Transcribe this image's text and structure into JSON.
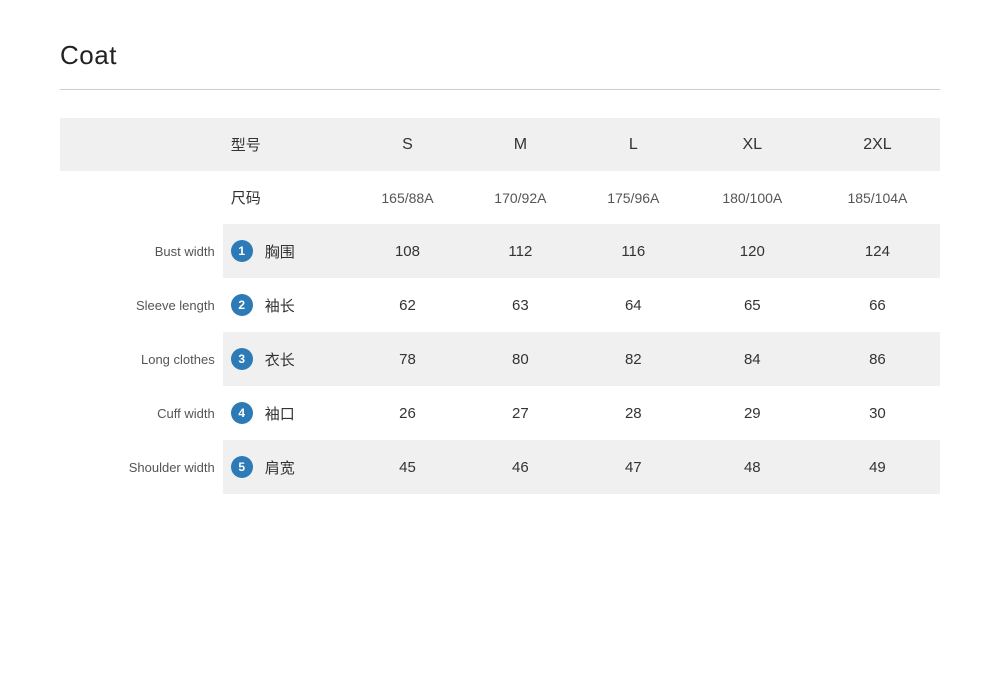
{
  "title": "Coat",
  "divider": true,
  "table": {
    "header": {
      "label_col": "型号",
      "sizes": [
        "S",
        "M",
        "L",
        "XL",
        "2XL"
      ]
    },
    "size_row": {
      "label_col": "尺码",
      "values": [
        "165/88A",
        "170/92A",
        "175/96A",
        "180/100A",
        "185/104A"
      ]
    },
    "rows": [
      {
        "en_label": "Bust width",
        "badge": "1",
        "zh_label": "胸围",
        "values": [
          "108",
          "112",
          "116",
          "120",
          "124"
        ]
      },
      {
        "en_label": "Sleeve length",
        "badge": "2",
        "zh_label": "袖长",
        "values": [
          "62",
          "63",
          "64",
          "65",
          "66"
        ]
      },
      {
        "en_label": "Long clothes",
        "badge": "3",
        "zh_label": "衣长",
        "values": [
          "78",
          "80",
          "82",
          "84",
          "86"
        ]
      },
      {
        "en_label": "Cuff width",
        "badge": "4",
        "zh_label": "袖口",
        "values": [
          "26",
          "27",
          "28",
          "29",
          "30"
        ]
      },
      {
        "en_label": "Shoulder width",
        "badge": "5",
        "zh_label": "肩宽",
        "values": [
          "45",
          "46",
          "47",
          "48",
          "49"
        ]
      }
    ]
  }
}
